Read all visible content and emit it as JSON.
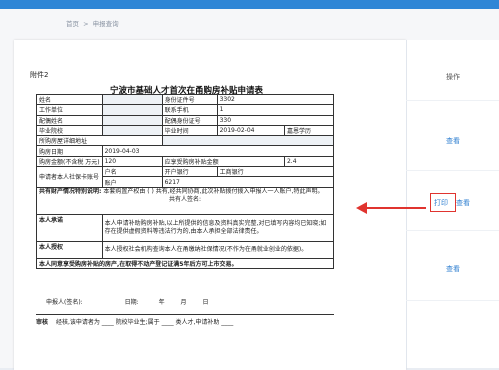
{
  "breadcrumb": {
    "home": "首页",
    "sep": ">",
    "current": "申报查询"
  },
  "doc": {
    "attachment": "附件2",
    "title": "宁波市基础人才首次在甬购房补贴申请表",
    "rows": [
      [
        "姓名",
        "",
        "身份证件号",
        "3302"
      ],
      [
        "工作单位",
        "",
        "联系手机",
        "1"
      ],
      [
        "配偶姓名",
        "",
        "配偶身份证号",
        "330"
      ],
      [
        "毕业院校",
        "",
        "毕业时间",
        "2019-02-04",
        "嘉恩学历"
      ],
      [
        "所购房屋详细地址",
        "",
        "",
        ""
      ],
      [
        "购房日期",
        "2019-04-03",
        "",
        ""
      ],
      [
        "购房金额(不含税 万元)",
        "120",
        "应享受购房补贴金额",
        "2.4"
      ],
      [
        "申请者本人社保卡账号",
        "户名",
        "开户银行",
        "工商银行"
      ],
      [
        "",
        "账户",
        "6217",
        ""
      ]
    ],
    "declaration_title": "共有财产情况特别说明:",
    "declaration_text": "本套购置产权由 ( ) 共有,经共同协商,此次补贴拨付拨入申报人一人账户,特此声明。",
    "co_owner": "共有人签名:",
    "promise_label": "本人承诺",
    "promise_text": "本人申请补助购房补贴,以上所提供的信息及资料真实完整,对已填写内容均已知晓;如存在提供虚假资料等违法行为的,由本人承担全部法律责任。",
    "auth_label": "本人授权",
    "auth_text": "本人授权社会机构查询本人在甬缴纳社保情况(不作为在甬就业创业的依据)。",
    "agree_text": "本人同意享受购房补贴的房产,在取得不动产登记证满5年后方可上市交易。",
    "applicant_sign": "申报人(签名):",
    "date_label": "日期:",
    "year": "年",
    "month": "月",
    "day": "日",
    "review_label": "审核",
    "review_text": "经核,该申请者为 ____ 院校毕业生;属于 ____ 类人才,申请补助 ____"
  },
  "panel": {
    "col_header": "操作",
    "actions": [
      "查看",
      "打印",
      "查看",
      "查看"
    ]
  },
  "colors": {
    "accent": "#2f86d6",
    "highlight": "#e0342f",
    "link": "#2f7fd0"
  }
}
